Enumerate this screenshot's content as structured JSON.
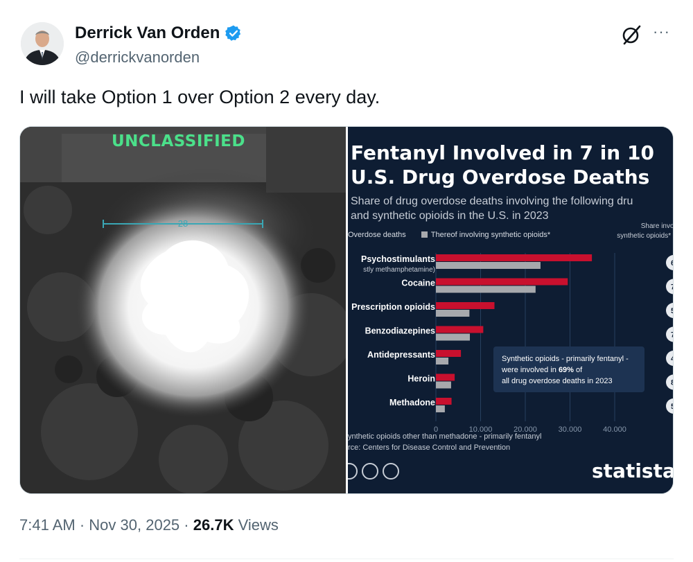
{
  "author": {
    "display_name": "Derrick Van Orden",
    "handle": "@derrickvanorden",
    "verified": true,
    "verified_color": "#1d9bf0"
  },
  "actions": {
    "grok_icon": "grok-slash-circle-icon",
    "more_icon": "more-horizontal-icon",
    "more_label": "···"
  },
  "tweet": {
    "text": "I will take Option 1 over Option 2 every day."
  },
  "media": {
    "left_image": {
      "overlay_text": "UNCLASSIFIED",
      "reticle_number": "28"
    },
    "right_image": {
      "title": "Fentanyl Involved in 7 in 10 U.S. Drug Overdose Deaths",
      "subtitle_line1": "Share of drug overdose deaths involving the following dru",
      "subtitle_line2": "and synthetic opioids in the U.S. in 2023",
      "legend_first": "Overdose deaths",
      "legend_second": "Thereof involving synthetic opioids*",
      "share_header_line1": "Share involvi",
      "share_header_line2": "synthetic opioids* (in",
      "category_sublabel": "stly methamphetamine)",
      "note_part1": "Synthetic opioids - primarily fentanyl -",
      "note_part2": "were involved in",
      "note_pct": "69%",
      "note_part3": "of",
      "note_part4": "all drug overdose deaths in 2023",
      "footnote": "ynthetic opioids other than methadone - primarily fentanyl",
      "source": "rce: Centers for Disease Control and Prevention",
      "brand": "statista",
      "share_values_visible": [
        "6",
        "7",
        "5",
        "7",
        "4",
        "8",
        "5"
      ]
    }
  },
  "chart_data": {
    "type": "bar",
    "orientation": "horizontal",
    "categories": [
      "Psychostimulants",
      "Cocaine",
      "Prescription opioids",
      "Benzodiazepines",
      "Antidepressants",
      "Heroin",
      "Methadone"
    ],
    "series": [
      {
        "name": "Overdose deaths",
        "color": "#c8102e",
        "values": [
          34900,
          29500,
          13100,
          10600,
          5600,
          4200,
          3500
        ]
      },
      {
        "name": "Thereof involving synthetic opioids*",
        "color": "#a7a9ad",
        "values": [
          23400,
          22300,
          7500,
          7600,
          2800,
          3400,
          2000
        ]
      }
    ],
    "xticks": [
      "0",
      "10,000",
      "20,000",
      "30,000",
      "40,000"
    ],
    "xlim": [
      0,
      40000
    ],
    "grid": true
  },
  "footer": {
    "time": "7:41 AM",
    "separator": "·",
    "date": "Nov 30, 2025",
    "views_count": "26.7K",
    "views_label": "Views"
  }
}
